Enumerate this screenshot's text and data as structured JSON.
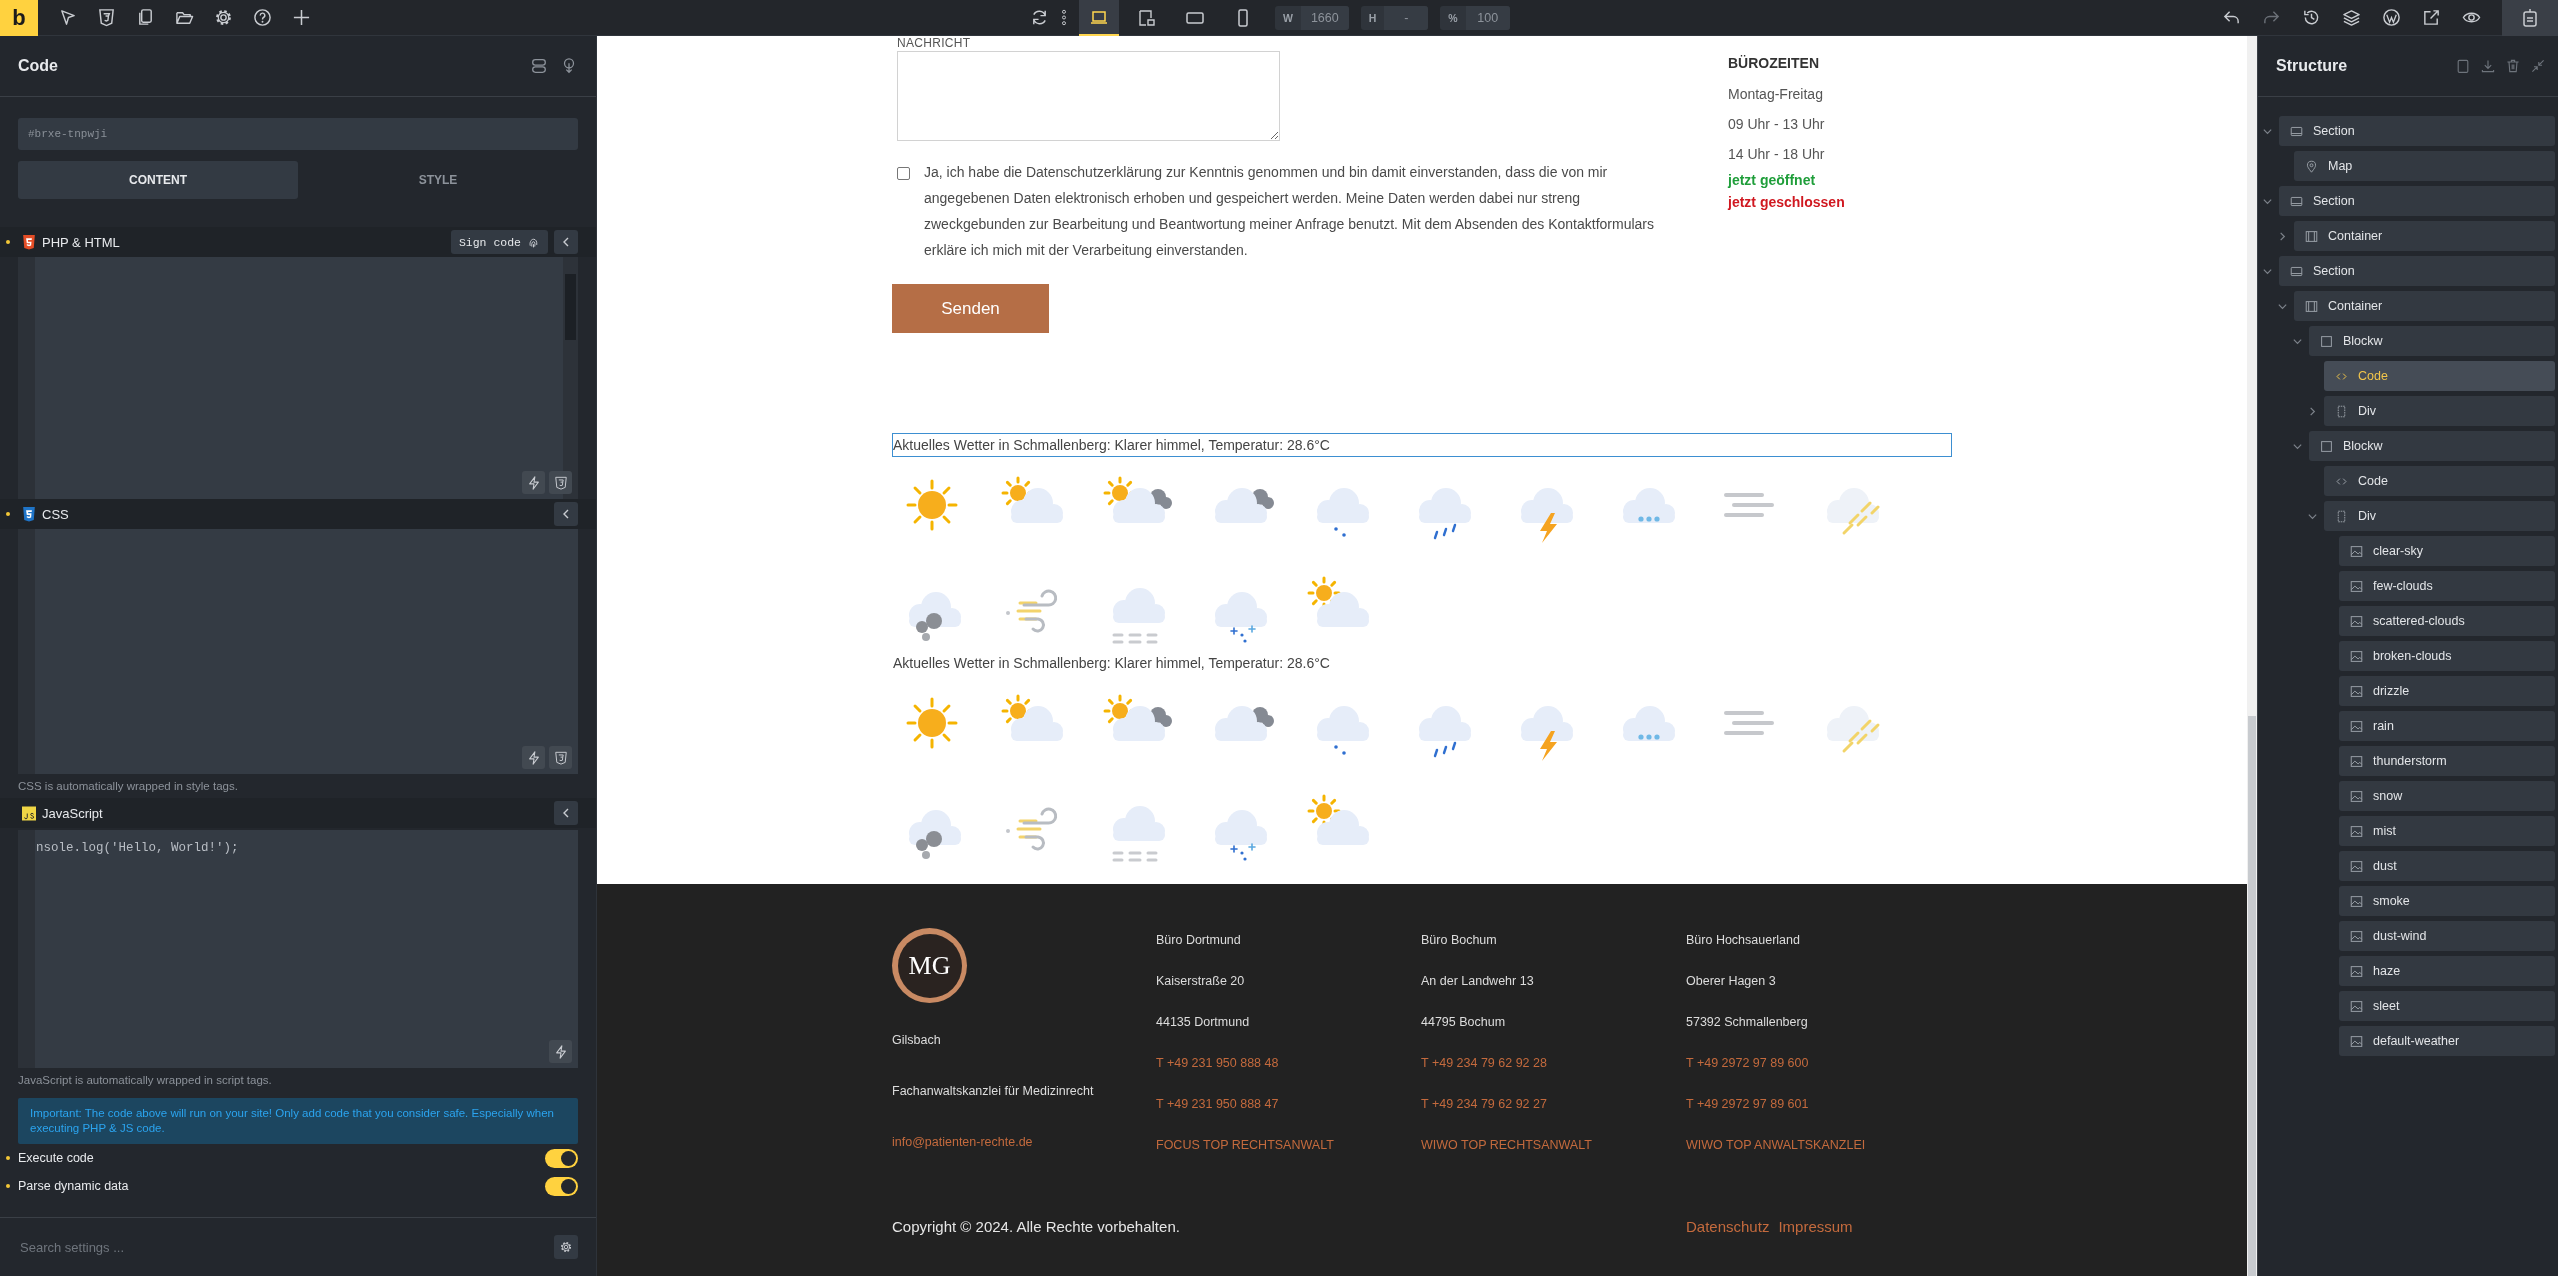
{
  "toolbar": {
    "logo": "b",
    "breakpoints": [
      {
        "kind": "desktop",
        "selected": true
      },
      {
        "kind": "tablet-landscape",
        "selected": false
      },
      {
        "kind": "tablet",
        "selected": false
      },
      {
        "kind": "phone",
        "selected": false
      }
    ],
    "fields": [
      {
        "label": "W",
        "value": "1660"
      },
      {
        "label": "H",
        "value": "-"
      },
      {
        "label": "%",
        "value": "100"
      }
    ]
  },
  "panel": {
    "title": "Code",
    "element_id": "#brxe-tnpwji",
    "tabs": [
      {
        "label": "CONTENT",
        "selected": true
      },
      {
        "label": "STYLE",
        "selected": false
      }
    ],
    "editors": [
      {
        "kind": "php",
        "title": "PHP & HTML",
        "modified": true,
        "sign_button": "Sign code"
      },
      {
        "kind": "css",
        "title": "CSS",
        "modified": true,
        "note": "CSS is automatically wrapped in style tags."
      },
      {
        "kind": "js",
        "title": "JavaScript",
        "code": "nsole.log('Hello, World!');",
        "note": "JavaScript is automatically wrapped in script tags."
      }
    ],
    "warning": "Important: The code above will run on your site! Only add code that you consider safe. Especially when executing PHP & JS code.",
    "toggles": [
      {
        "label": "Execute code",
        "modified": true,
        "on": true
      },
      {
        "label": "Parse dynamic data",
        "modified": true,
        "on": true
      }
    ],
    "search": {
      "placeholder": "Search settings ..."
    }
  },
  "page": {
    "form": {
      "message_label": "NACHRICHT",
      "consent": {
        "checked": false,
        "text": "Ja, ich habe die Datenschutzerklärung zur Kenntnis genommen und bin damit einverstanden, dass die von mir angegebenen Daten elektronisch erhoben und gespeichert werden. Meine Daten werden dabei nur streng zweckgebunden zur Bearbeitung und Beantwortung meiner Anfrage benutzt. Mit dem Absenden des Kontaktformulars erkläre ich mich mit der Verarbeitung einverstanden."
      },
      "submit": "Senden"
    },
    "hours": {
      "title": "BÜROZEITEN",
      "lines": [
        "Montag-Freitag",
        "09 Uhr - 13 Uhr",
        "14 Uhr - 18 Uhr"
      ],
      "status": [
        {
          "text": "jetzt geöffnet",
          "color": "#1f9e3a"
        },
        {
          "text": "jetzt geschlossen",
          "color": "#d01820"
        }
      ]
    },
    "weather": [
      {
        "text": "Aktuelles Wetter in Schmallenberg: Klarer himmel, Temperatur: 28.6°C",
        "selected": true,
        "icons": [
          {
            "kind": "clear-sky"
          },
          {
            "kind": "few-clouds"
          },
          {
            "kind": "scattered-clouds"
          },
          {
            "kind": "broken-clouds"
          },
          {
            "kind": "drizzle"
          },
          {
            "kind": "rain"
          },
          {
            "kind": "thunderstorm"
          },
          {
            "kind": "snow"
          },
          {
            "kind": "mist"
          },
          {
            "kind": "dust"
          },
          {
            "kind": "smoke"
          },
          {
            "kind": "dust-wind"
          },
          {
            "kind": "haze"
          },
          {
            "kind": "sleet"
          },
          {
            "kind": "default-weather"
          }
        ]
      },
      {
        "text": "Aktuelles Wetter in Schmallenberg: Klarer himmel, Temperatur: 28.6°C",
        "selected": false,
        "icons": [
          {
            "kind": "clear-sky"
          },
          {
            "kind": "few-clouds"
          },
          {
            "kind": "scattered-clouds"
          },
          {
            "kind": "broken-clouds"
          },
          {
            "kind": "drizzle"
          },
          {
            "kind": "rain"
          },
          {
            "kind": "thunderstorm"
          },
          {
            "kind": "snow"
          },
          {
            "kind": "mist"
          },
          {
            "kind": "dust"
          },
          {
            "kind": "smoke"
          },
          {
            "kind": "dust-wind"
          },
          {
            "kind": "haze"
          },
          {
            "kind": "sleet"
          },
          {
            "kind": "default-weather"
          }
        ]
      }
    ],
    "footer": {
      "logo": "MG",
      "left": [
        {
          "text": "Gilsbach",
          "kind": "text"
        },
        {
          "text": "Fachanwaltskanzlei für Medizinrecht",
          "kind": "text"
        },
        {
          "text": "info@patienten-rechte.de",
          "kind": "link"
        }
      ],
      "offices": [
        {
          "lines": [
            {
              "text": "Büro Dortmund",
              "kind": "text"
            },
            {
              "text": "Kaiserstraße 20",
              "kind": "text"
            },
            {
              "text": "44135 Dortmund",
              "kind": "text"
            },
            {
              "text": "T +49 231 950 888 48",
              "kind": "link"
            },
            {
              "text": "T +49 231 950 888 47",
              "kind": "link"
            },
            {
              "text": "FOCUS TOP RECHTSANWALT",
              "kind": "link"
            }
          ]
        },
        {
          "lines": [
            {
              "text": "Büro Bochum",
              "kind": "text"
            },
            {
              "text": "An der Landwehr 13",
              "kind": "text"
            },
            {
              "text": "44795 Bochum",
              "kind": "text"
            },
            {
              "text": "T +49 234 79 62 92 28",
              "kind": "link"
            },
            {
              "text": "T +49 234 79 62 92 27",
              "kind": "link"
            },
            {
              "text": "WIWO TOP RECHTSANWALT",
              "kind": "link"
            }
          ]
        },
        {
          "lines": [
            {
              "text": "Büro Hochsauerland",
              "kind": "text"
            },
            {
              "text": "Oberer Hagen 3",
              "kind": "text"
            },
            {
              "text": "57392 Schmallenberg",
              "kind": "text"
            },
            {
              "text": "T +49 2972 97 89 600",
              "kind": "link"
            },
            {
              "text": "T +49 2972 97 89 601",
              "kind": "link"
            },
            {
              "text": "WIWO TOP ANWALTSKANZLEI",
              "kind": "link"
            }
          ]
        }
      ],
      "copyright": "Copyright © 2024. Alle Rechte vorbehalten.",
      "links": [
        "Datenschutz",
        "Impressum"
      ]
    }
  },
  "structure": {
    "title": "Structure",
    "items": [
      {
        "label": "Section",
        "kind": "section",
        "selected": false,
        "expanded": true,
        "children": [
          {
            "label": "Map",
            "kind": "map",
            "selected": false
          }
        ]
      },
      {
        "label": "Section",
        "kind": "section",
        "selected": false,
        "expanded": true,
        "children": [
          {
            "label": "Container",
            "kind": "container",
            "selected": false,
            "expanded": false
          }
        ]
      },
      {
        "label": "Section",
        "kind": "section",
        "selected": false,
        "expanded": true,
        "children": [
          {
            "label": "Container",
            "kind": "container",
            "selected": false,
            "expanded": true,
            "children": [
              {
                "label": "Blockw",
                "kind": "block",
                "selected": false,
                "expanded": true,
                "children": [
                  {
                    "label": "Code",
                    "kind": "code",
                    "selected": true
                  },
                  {
                    "label": "Div",
                    "kind": "div",
                    "selected": false,
                    "expanded": false
                  }
                ]
              },
              {
                "label": "Blockw",
                "kind": "block",
                "selected": false,
                "expanded": true,
                "children": [
                  {
                    "label": "Code",
                    "kind": "code",
                    "selected": false
                  },
                  {
                    "label": "Div",
                    "kind": "div",
                    "selected": false,
                    "expanded": true,
                    "children": [
                      {
                        "label": "clear-sky",
                        "kind": "image",
                        "selected": false
                      },
                      {
                        "label": "few-clouds",
                        "kind": "image",
                        "selected": false
                      },
                      {
                        "label": "scattered-clouds",
                        "kind": "image",
                        "selected": false
                      },
                      {
                        "label": "broken-clouds",
                        "kind": "image",
                        "selected": false
                      },
                      {
                        "label": "drizzle",
                        "kind": "image",
                        "selected": false
                      },
                      {
                        "label": "rain",
                        "kind": "image",
                        "selected": false
                      },
                      {
                        "label": "thunderstorm",
                        "kind": "image",
                        "selected": false
                      },
                      {
                        "label": "snow",
                        "kind": "image",
                        "selected": false
                      },
                      {
                        "label": "mist",
                        "kind": "image",
                        "selected": false
                      },
                      {
                        "label": "dust",
                        "kind": "image",
                        "selected": false
                      },
                      {
                        "label": "smoke",
                        "kind": "image",
                        "selected": false
                      },
                      {
                        "label": "dust-wind",
                        "kind": "image",
                        "selected": false
                      },
                      {
                        "label": "haze",
                        "kind": "image",
                        "selected": false
                      },
                      {
                        "label": "sleet",
                        "kind": "image",
                        "selected": false
                      },
                      {
                        "label": "default-weather",
                        "kind": "image",
                        "selected": false
                      }
                    ]
                  }
                ]
              }
            ]
          }
        ]
      }
    ]
  }
}
